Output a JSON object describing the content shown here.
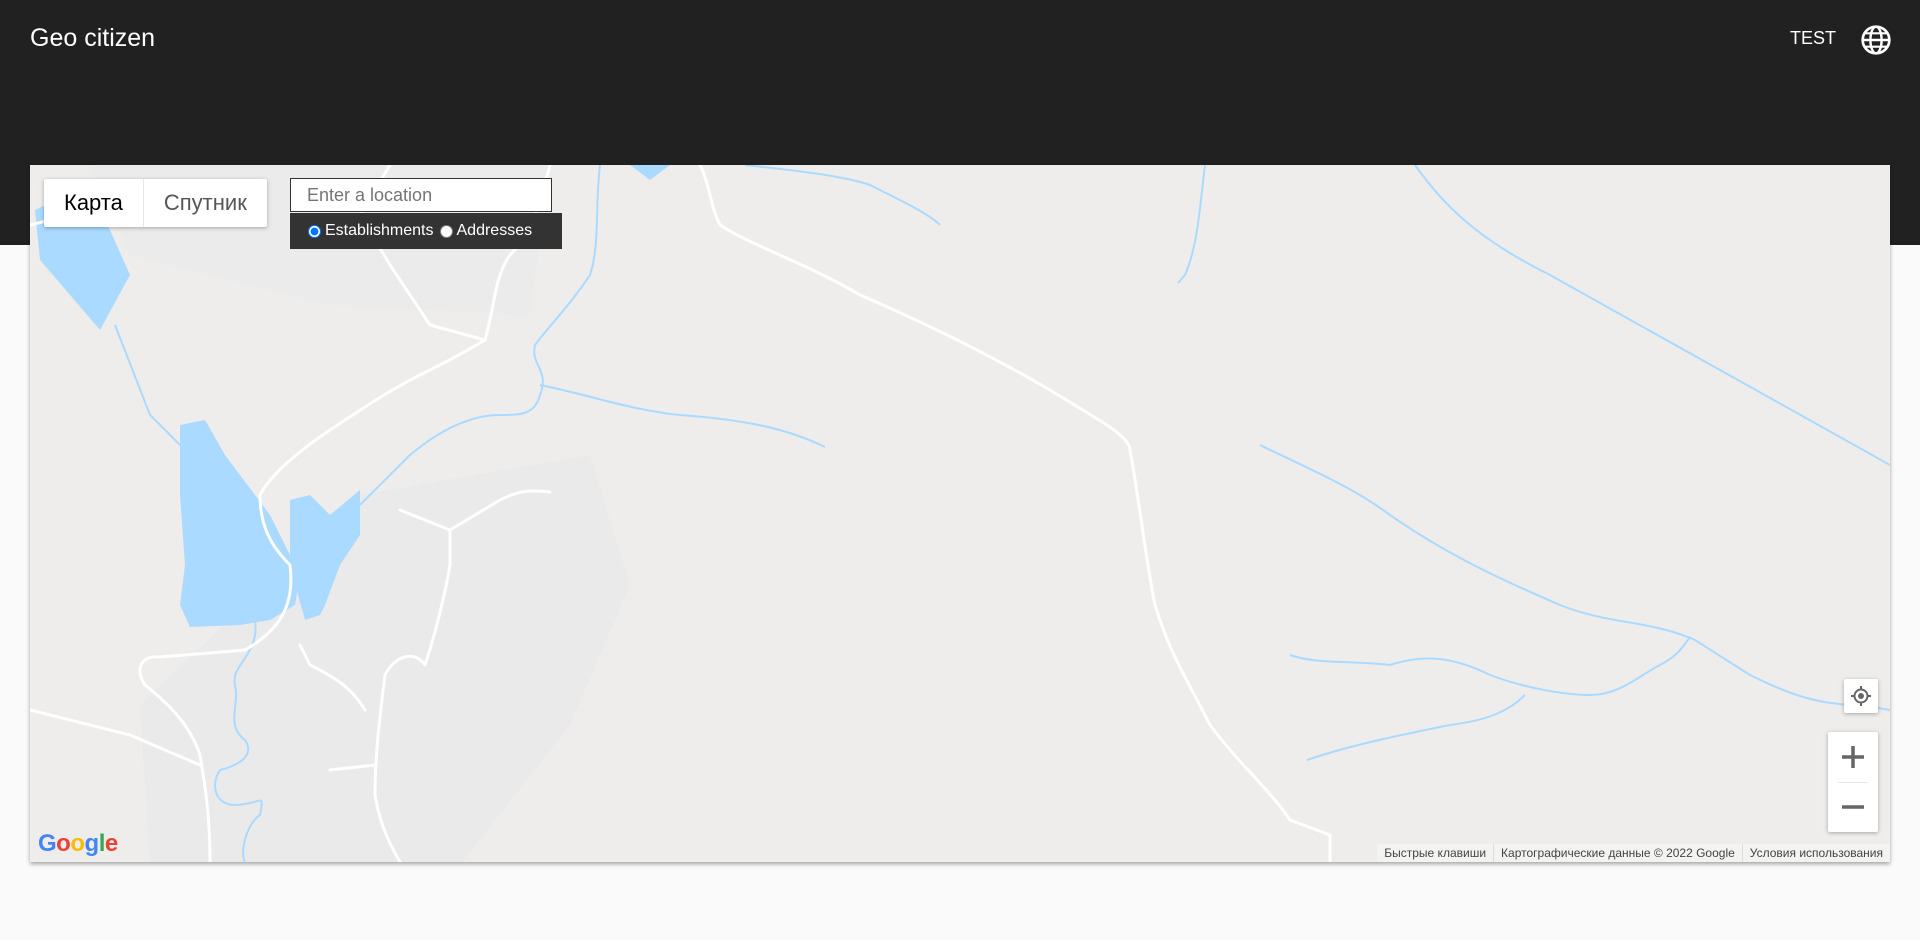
{
  "header": {
    "title": "Geo citizen",
    "user_label": "TEST",
    "language_icon": "globe-icon"
  },
  "map": {
    "type_buttons": [
      "Карта",
      "Спутник"
    ],
    "search": {
      "placeholder": "Enter a location",
      "value": ""
    },
    "search_types": [
      "Establishments",
      "Addresses"
    ],
    "search_type_selected": "Establishments",
    "logo": [
      "G",
      "o",
      "o",
      "g",
      "l",
      "e"
    ],
    "logo_colors": [
      "#4285F4",
      "#EA4335",
      "#FBBC05",
      "#4285F4",
      "#34A853",
      "#EA4335"
    ],
    "attribution": [
      "Быстрые клавиши",
      "Картографические данные © 2022 Google",
      "Условия использования"
    ],
    "colors": {
      "land": "#eeedeb",
      "water": "#aadaff",
      "road": "#ffffff"
    },
    "controls": {
      "my_location_icon": "my-location-icon",
      "zoom_in_icon": "plus-icon",
      "zoom_out_icon": "minus-icon"
    }
  }
}
